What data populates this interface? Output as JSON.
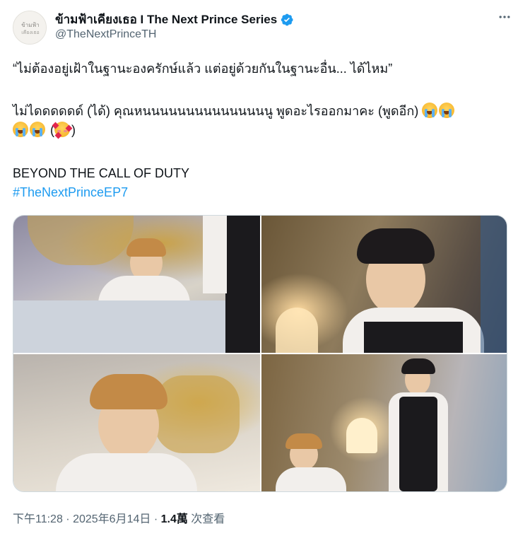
{
  "account": {
    "display_name": "ข้ามฟ้าเคียงเธอ I The Next Prince Series",
    "handle": "@TheNextPrinceTH",
    "avatar_text": "ข้ามฟ้า เคียงเธอ",
    "verified": true,
    "verified_color": "#1d9bf0"
  },
  "tweet": {
    "line1": "“ไม่ต้องอยู่เฝ้าในฐานะองครักษ์แล้ว แต่อยู่ด้วยกันในฐานะอื่น... ได้ไหม”",
    "line2": "ไม่ไดดดดดด์ (ได้) คุณหนนนนนนนนนนนนนนนู พูดอะไรออกมาคะ (พูดอีก) ",
    "line2_end": " (",
    "line2_close": ")",
    "line3": "BEYOND THE CALL OF DUTY",
    "hashtag": "#TheNextPrinceEP7",
    "hashtag_color": "#1d9bf0",
    "emojis": [
      "loudly-crying-face",
      "loudly-crying-face",
      "loudly-crying-face",
      "loudly-crying-face",
      "smiling-face-with-hearts"
    ]
  },
  "media": {
    "photos": [
      {
        "name": "photo-boy-on-bed-holding-arm"
      },
      {
        "name": "photo-man-in-vest-looking-down"
      },
      {
        "name": "photo-boy-looking-up"
      },
      {
        "name": "photo-man-standing-by-bed"
      }
    ]
  },
  "footer": {
    "time": "下午11:28",
    "separator": " · ",
    "date": "2025年6月14日",
    "views": "1.4萬",
    "views_label": " 次查看"
  },
  "icons": {
    "more": "more-horizontal-icon",
    "verified": "verified-badge-icon"
  }
}
